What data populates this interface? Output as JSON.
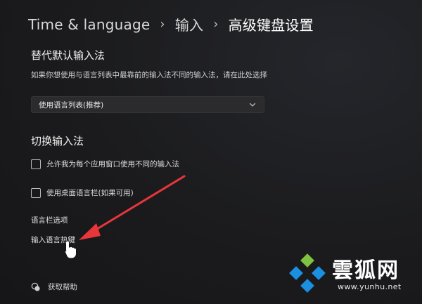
{
  "breadcrumb": {
    "items": [
      "Time & language",
      "输入"
    ],
    "current": "高级键盘设置",
    "separator": "›"
  },
  "override_section": {
    "title": "替代默认输入法",
    "description": "如果你想使用与语言列表中最靠前的输入法不同的输入法，请在此处选择",
    "dropdown": {
      "value": "使用语言列表(推荐)"
    }
  },
  "switch_section": {
    "title": "切换输入法",
    "options": [
      {
        "label": "允许我为每个应用窗口使用不同的输入法",
        "checked": false
      },
      {
        "label": "使用桌面语言栏(如果可用)",
        "checked": false
      }
    ]
  },
  "links": {
    "language_bar_options": "语言栏选项",
    "input_hotkeys": "输入语言热键"
  },
  "help": {
    "label": "获取帮助"
  },
  "watermark": {
    "text": "雲狐网",
    "url": "www.yunhu.net"
  },
  "colors": {
    "background": "#1c1c1e",
    "arrow": "#e8363a",
    "watermark_blue": "#1b8fe0",
    "watermark_green": "#7fc241"
  },
  "icons": {
    "dropdown": "chevron-down-icon",
    "help": "help-chat-icon",
    "cursor": "hand-pointer-icon",
    "annotation": "red-arrow-annotation"
  }
}
